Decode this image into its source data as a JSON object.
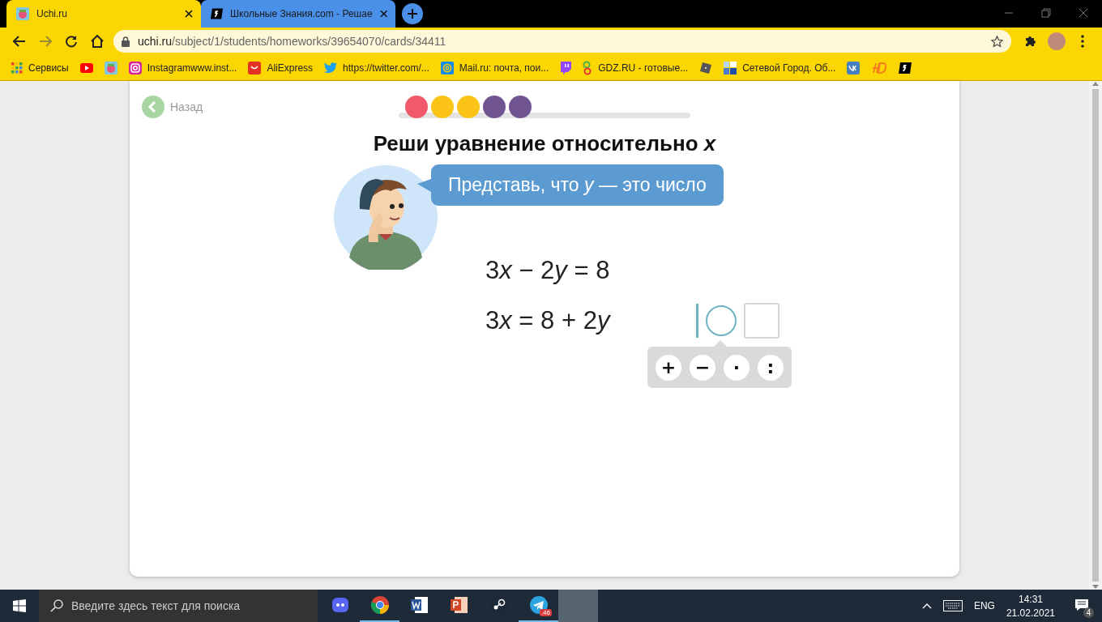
{
  "browser": {
    "tabs": [
      {
        "title": "Uchi.ru",
        "selected": true
      },
      {
        "title": "Школьные Знания.com - Решае",
        "selected": false
      }
    ],
    "address": {
      "host": "uchi.ru",
      "path": "/subject/1/students/homeworks/39654070/cards/34411"
    },
    "bookmarks": [
      {
        "kind": "apps",
        "label": "Сервисы"
      },
      {
        "kind": "youtube"
      },
      {
        "kind": "uchi"
      },
      {
        "kind": "instagram",
        "label": "Instagramwww.inst..."
      },
      {
        "kind": "aliexpress",
        "label": "AliExpress"
      },
      {
        "kind": "twitter",
        "label": "https://twitter.com/..."
      },
      {
        "kind": "mail",
        "label": "Mail.ru: почта, пои..."
      },
      {
        "kind": "twitch"
      },
      {
        "kind": "gdz",
        "label": "GDZ.RU - готовые..."
      },
      {
        "kind": "roblox"
      },
      {
        "kind": "netcity",
        "label": "Сетевой Город. Об..."
      },
      {
        "kind": "vk"
      },
      {
        "kind": "hd"
      },
      {
        "kind": "znania"
      }
    ]
  },
  "lesson": {
    "back": "Назад",
    "progress": [
      {
        "color": "#f05a6a"
      },
      {
        "color": "#fcc417"
      },
      {
        "color": "#fcc417"
      },
      {
        "color": "#715593"
      },
      {
        "color": "#715593"
      }
    ],
    "title": "Реши уравнение относительно *x*",
    "hint": "Представь, что *y* — это число",
    "equations": [
      [
        {
          "text": "3"
        },
        {
          "text": "x",
          "italic": true
        },
        {
          "text": " − 2"
        },
        {
          "text": "y",
          "italic": true
        },
        {
          "text": " = 8"
        }
      ],
      [
        {
          "text": "3"
        },
        {
          "text": "x",
          "italic": true
        },
        {
          "text": " = 8 + 2"
        },
        {
          "text": "y",
          "italic": true
        }
      ]
    ],
    "answer_slots": [
      {
        "kind": "circle",
        "selected": true
      },
      {
        "kind": "square",
        "selected": false
      }
    ],
    "operators": [
      "+",
      "−",
      "·",
      ":"
    ]
  },
  "taskbar": {
    "search_placeholder": "Введите здесь текст для поиска",
    "apps": [
      {
        "kind": "discord",
        "running": false,
        "selected": false
      },
      {
        "kind": "chrome",
        "running": true,
        "selected": false
      },
      {
        "kind": "word",
        "running": false,
        "selected": false
      },
      {
        "kind": "powerpoint",
        "running": false,
        "selected": false
      },
      {
        "kind": "steam",
        "running": false,
        "selected": false
      },
      {
        "kind": "telegram",
        "running": true,
        "selected": false,
        "badge": ".46"
      },
      {
        "kind": "blank",
        "running": false,
        "selected": true
      }
    ],
    "language": "ENG",
    "time": "14:31",
    "date": "21.02.2021",
    "notifications": "4"
  }
}
